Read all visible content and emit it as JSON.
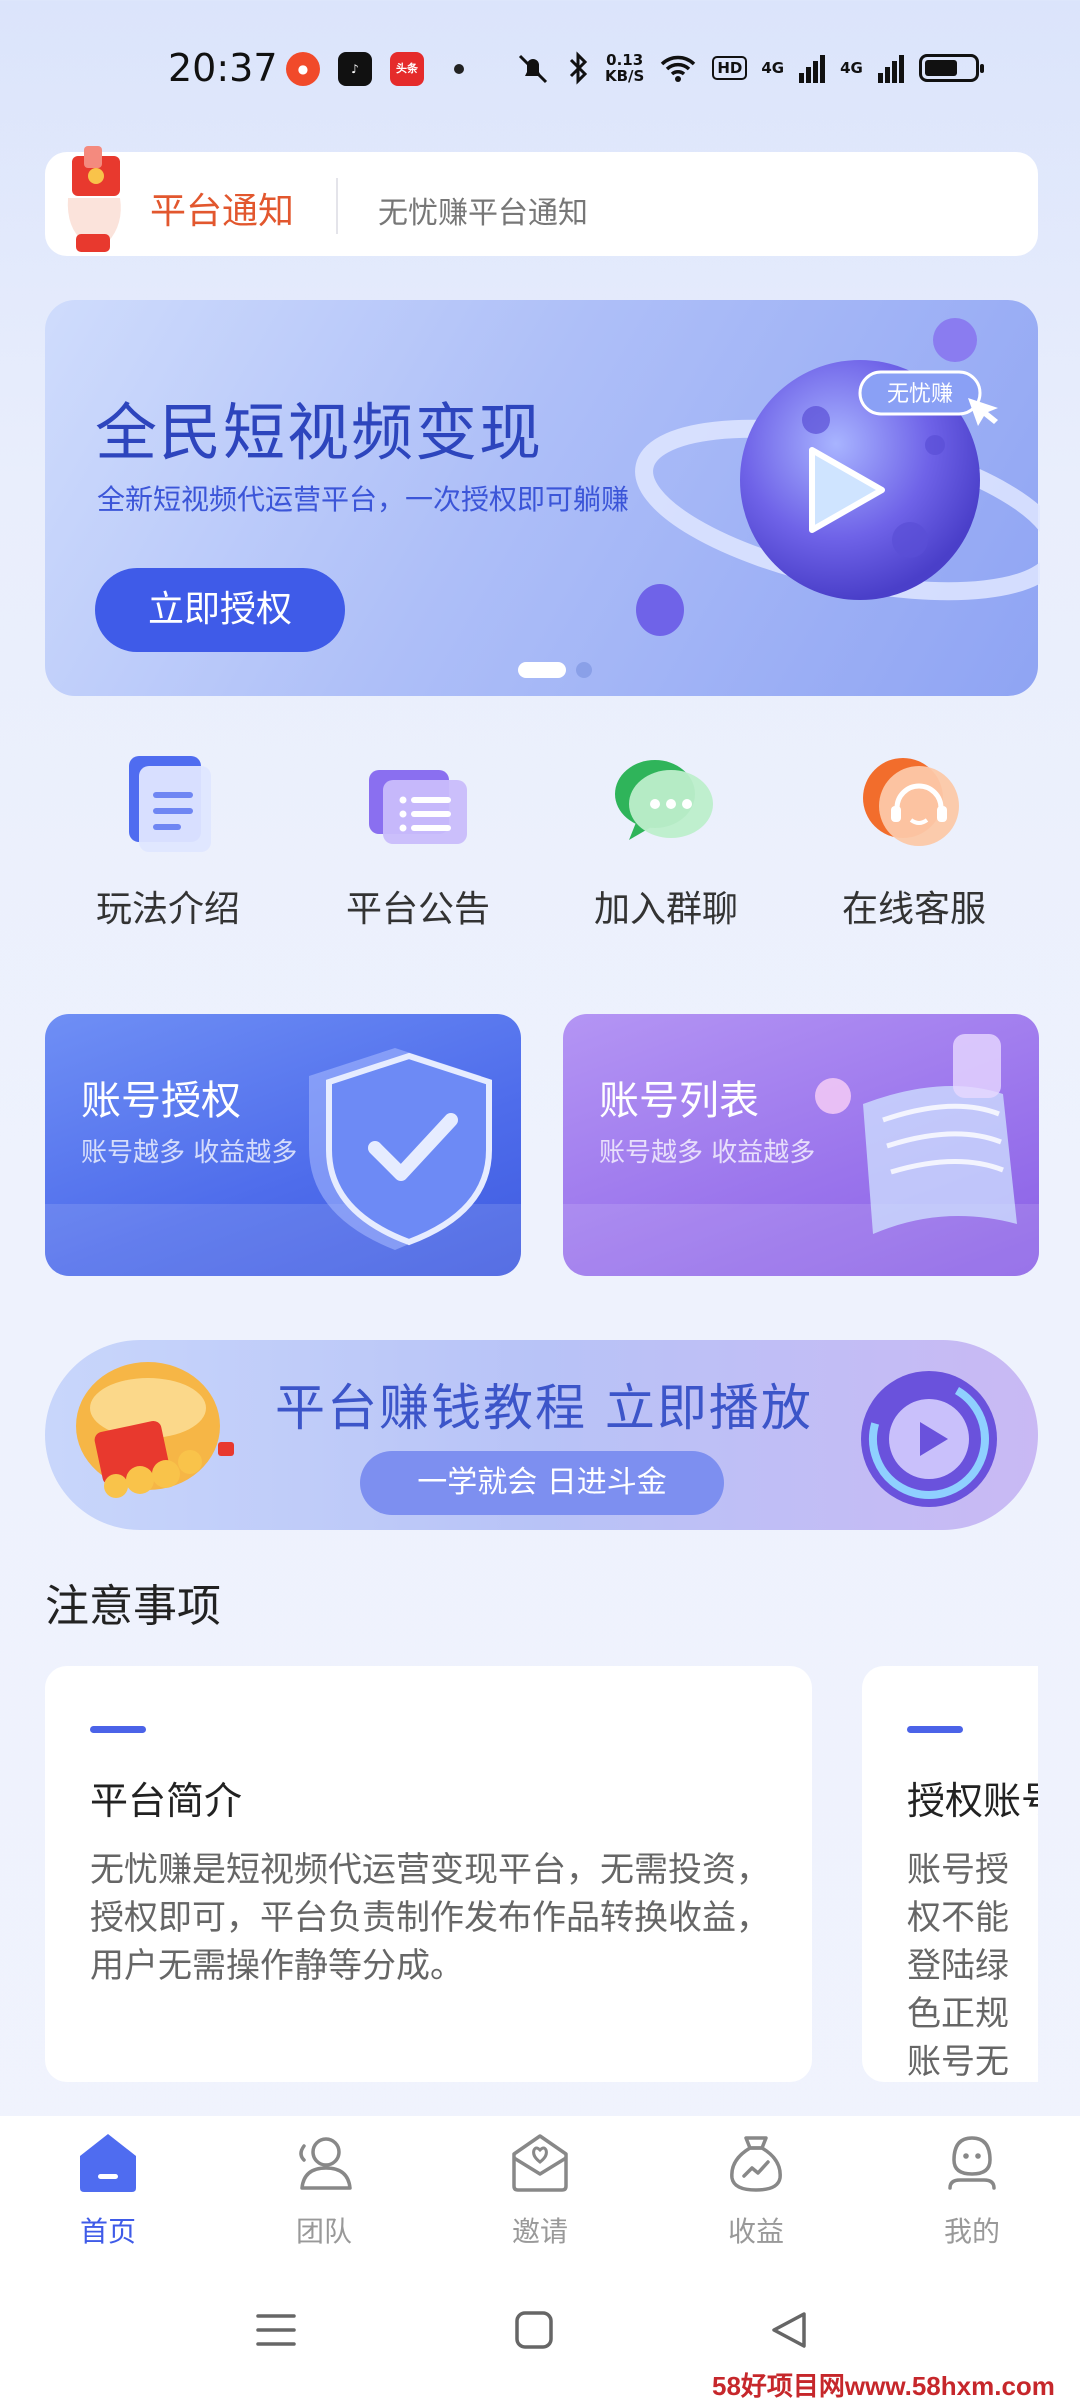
{
  "status_bar": {
    "time": "20:37",
    "apps": [
      "weibo-icon",
      "douyin-icon",
      "toutiao-icon"
    ],
    "toutiao_label": "头条",
    "net_speed_value": "0.13",
    "net_speed_unit": "KB/S",
    "hd_label": "HD",
    "signal_1": "4G",
    "signal_2": "4G"
  },
  "notice": {
    "title": "平台通知",
    "text": "无忧赚平台通知"
  },
  "banner": {
    "title": "全民短视频变现",
    "subtitle": "全新短视频代运营平台，一次授权即可躺赚",
    "button": "立即授权",
    "tag": "无忧赚",
    "active_slide": 1,
    "slide_count": 2
  },
  "quick_menu": [
    {
      "label": "玩法介绍",
      "icon": "document-icon"
    },
    {
      "label": "平台公告",
      "icon": "announcement-list-icon"
    },
    {
      "label": "加入群聊",
      "icon": "chat-bubble-icon"
    },
    {
      "label": "在线客服",
      "icon": "customer-service-headset-icon"
    }
  ],
  "feature_cards": [
    {
      "title": "账号授权",
      "subtitle": "账号越多 收益越多",
      "icon": "shield-check-icon"
    },
    {
      "title": "账号列表",
      "subtitle": "账号越多 收益越多",
      "icon": "list-scroll-icon"
    }
  ],
  "tutorial": {
    "title": "平台赚钱教程 立即播放",
    "pill": "一学就会 日进斗金"
  },
  "notes": {
    "title": "注意事项",
    "cards": [
      {
        "title": "平台简介",
        "body": "无忧赚是短视频代运营变现平台，无需投资，授权即可，平台负责制作发布作品转换收益，用户无需操作静等分成。"
      },
      {
        "title": "授权账号",
        "body": "账号授权不能登陆绿色正规账号无影"
      }
    ]
  },
  "tabs": [
    {
      "label": "首页",
      "icon": "home-icon",
      "active": true
    },
    {
      "label": "团队",
      "icon": "team-icon",
      "active": false
    },
    {
      "label": "邀请",
      "icon": "invite-envelope-icon",
      "active": false
    },
    {
      "label": "收益",
      "icon": "money-bag-icon",
      "active": false
    },
    {
      "label": "我的",
      "icon": "profile-icon",
      "active": false
    }
  ],
  "watermark": "58好项目网www.58hxm.com",
  "colors": {
    "accent": "#3f5be8",
    "notice_title": "#e2572e",
    "tab_inactive": "#999999"
  }
}
